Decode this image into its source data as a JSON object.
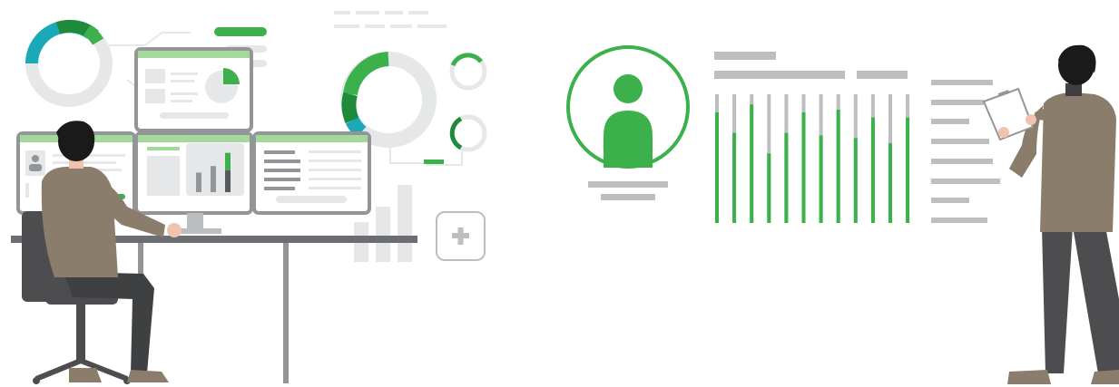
{
  "palette": {
    "accent_green": "#3cb04a",
    "dark_green": "#1e8a3c",
    "light_green": "#a3d99b",
    "teal": "#1aa9b6",
    "light_grey": "#e6e7e8",
    "mid_grey": "#bcbec0",
    "dark_grey": "#58595b",
    "jacket": "#8b7d6b",
    "trousers": "#4d4d4f",
    "hair": "#1a1a1a",
    "skin": "#f1c3ae"
  },
  "icons": {
    "plus": "plus-icon",
    "user": "user-profile-icon",
    "image": "image-placeholder-icon",
    "clipboard": "clipboard-icon"
  },
  "bar_chart_levels": [
    0.86,
    0.7,
    0.92,
    0.54,
    0.7,
    0.86,
    0.68,
    0.88,
    0.66,
    0.82,
    0.62,
    0.82
  ],
  "monitor_bar_levels": [
    0.45,
    0.6,
    0.9
  ]
}
